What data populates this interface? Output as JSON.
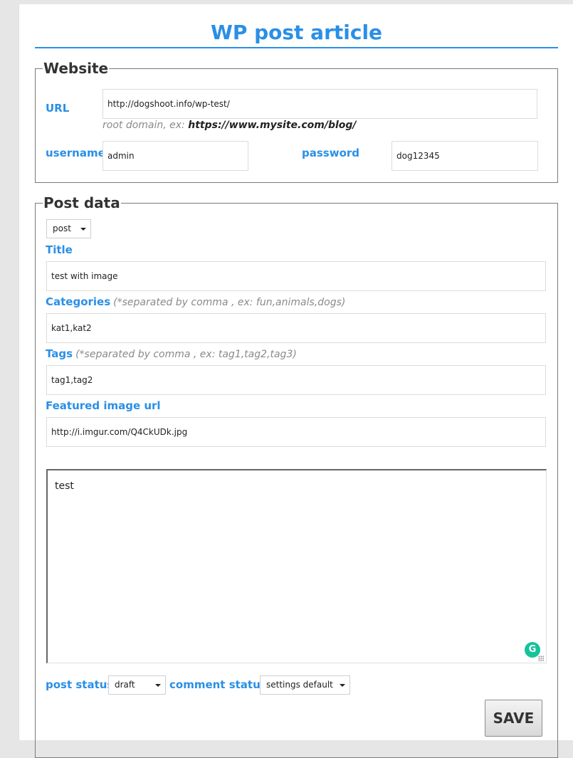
{
  "page_title": "WP post article",
  "website": {
    "legend": "Website",
    "url_label": "URL",
    "url_value": "http://dogshoot.info/wp-test/",
    "url_hint_prefix": "root domain, ex: ",
    "url_hint_example": "https://www.mysite.com/blog/",
    "username_label": "username",
    "username_value": "admin",
    "password_label": "password",
    "password_value": "dog12345"
  },
  "post_data": {
    "legend": "Post data",
    "type_select": "post",
    "title_label": "Title",
    "title_value": "test with image",
    "categories_label": "Categories",
    "categories_hint": "(*separated by comma , ex: fun,animals,dogs)",
    "categories_value": "kat1,kat2",
    "tags_label": "Tags",
    "tags_hint": "(*separated by comma , ex: tag1,tag2,tag3)",
    "tags_value": "tag1,tag2",
    "featured_label": "Featured image url",
    "featured_value": "http://i.imgur.com/Q4CkUDk.jpg",
    "content_value": "test",
    "post_status_label": "post status",
    "post_status_value": "draft",
    "comment_status_label": "comment status",
    "comment_status_value": "settings default",
    "save_label": "SAVE"
  },
  "icons": {
    "grammarly": "grammarly-icon",
    "select_caret": "chevron-down-icon"
  },
  "colors": {
    "accent": "#2a8fe6",
    "grammarly": "#15c39a"
  }
}
